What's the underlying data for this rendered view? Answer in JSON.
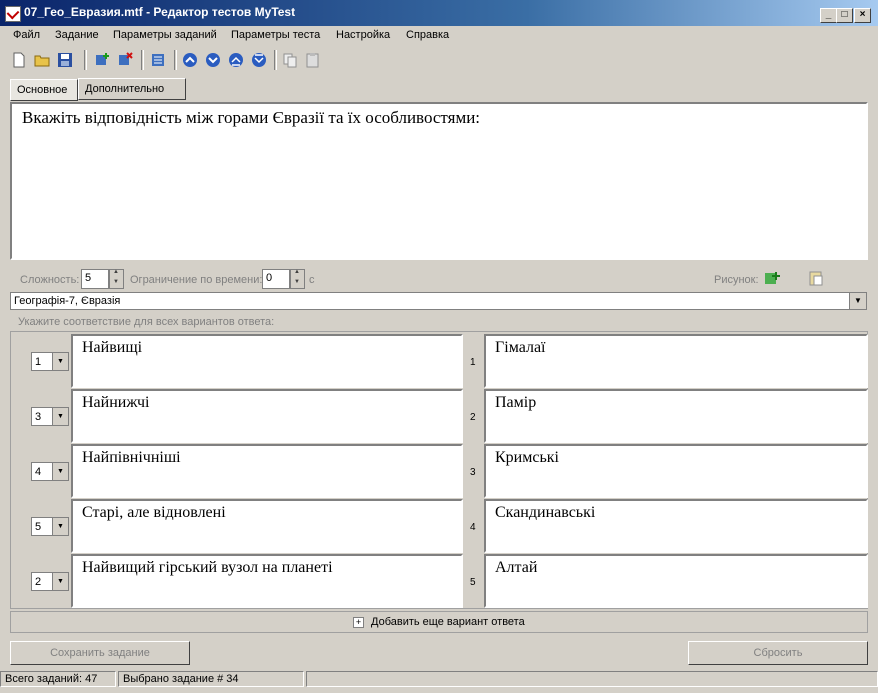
{
  "window": {
    "title": "07_Гео_Евразия.mtf - Редактор тестов MyTest"
  },
  "menu": [
    "Файл",
    "Задание",
    "Параметры заданий",
    "Параметры теста",
    "Настройка",
    "Справка"
  ],
  "tabs": [
    "Основное",
    "Дополнительно"
  ],
  "question": {
    "text": "Вкажіть відповідність між горами Євразії та їх особливостями:"
  },
  "params": {
    "difficulty_label": "Сложность:",
    "difficulty_value": "5",
    "time_label": "Ограничение по времени:",
    "time_value": "0",
    "time_unit": "с",
    "picture_label": "Рисунок:"
  },
  "topic": {
    "value": "Географія-7, Євразія"
  },
  "hint": "Укажите соответствие для всех вариантов ответа:",
  "pairs": [
    {
      "select": "1",
      "left": "Найвищі",
      "num": "1",
      "right": "Гімалаї"
    },
    {
      "select": "3",
      "left": "Найнижчі",
      "num": "2",
      "right": "Памір"
    },
    {
      "select": "4",
      "left": "Найпівнічніші",
      "num": "3",
      "right": "Кримські"
    },
    {
      "select": "5",
      "left": "Старі, але відновлені",
      "num": "4",
      "right": "Скандинавські"
    },
    {
      "select": "2",
      "left": "Найвищий гірський вузол на планеті",
      "num": "5",
      "right": "Алтай"
    }
  ],
  "add_answer": "Добавить еще вариант ответа",
  "buttons": {
    "save": "Сохранить задание",
    "reset": "Сбросить"
  },
  "status": {
    "total": "Всего заданий: 47",
    "selected": "Выбрано задание # 34"
  }
}
